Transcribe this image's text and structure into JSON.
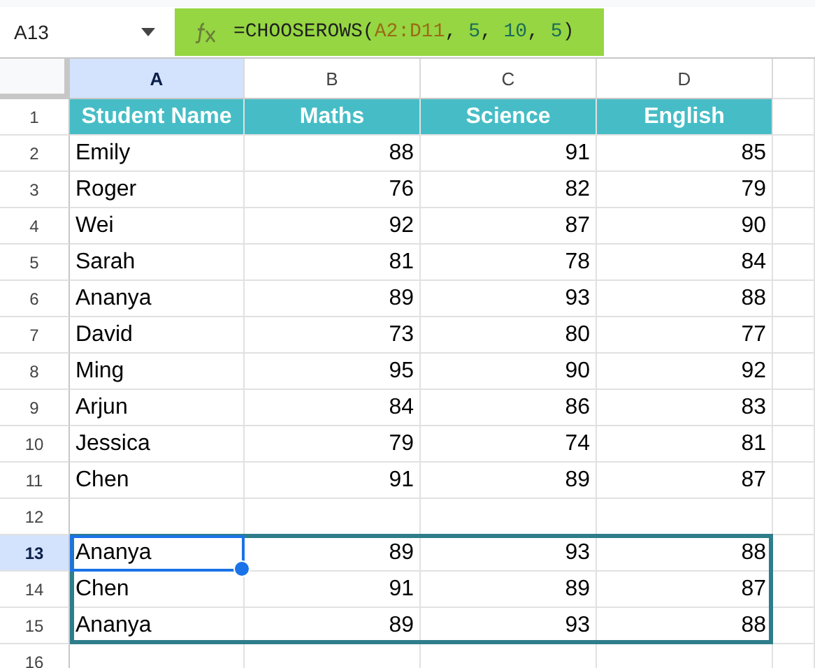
{
  "name_box": {
    "value": "A13"
  },
  "formula_bar": {
    "segments": [
      {
        "kind": "plain",
        "text": "=CHOOSEROWS("
      },
      {
        "kind": "range",
        "text": "A2:D11"
      },
      {
        "kind": "plain",
        "text": ", "
      },
      {
        "kind": "number",
        "text": "5"
      },
      {
        "kind": "plain",
        "text": ", "
      },
      {
        "kind": "number",
        "text": "10"
      },
      {
        "kind": "plain",
        "text": ", "
      },
      {
        "kind": "number",
        "text": "5"
      },
      {
        "kind": "plain",
        "text": ")"
      }
    ]
  },
  "columns": [
    {
      "label": "A",
      "selected": true
    },
    {
      "label": "B",
      "selected": false
    },
    {
      "label": "C",
      "selected": false
    },
    {
      "label": "D",
      "selected": false
    }
  ],
  "rows": [
    {
      "number": "1",
      "kind": "header",
      "selected": false,
      "in_output": false,
      "cells": [
        "Student Name",
        "Maths",
        "Science",
        "English"
      ]
    },
    {
      "number": "2",
      "kind": "data",
      "selected": false,
      "in_output": false,
      "cells": [
        "Emily",
        "88",
        "91",
        "85"
      ]
    },
    {
      "number": "3",
      "kind": "data",
      "selected": false,
      "in_output": false,
      "cells": [
        "Roger",
        "76",
        "82",
        "79"
      ]
    },
    {
      "number": "4",
      "kind": "data",
      "selected": false,
      "in_output": false,
      "cells": [
        "Wei",
        "92",
        "87",
        "90"
      ]
    },
    {
      "number": "5",
      "kind": "data",
      "selected": false,
      "in_output": false,
      "cells": [
        "Sarah",
        "81",
        "78",
        "84"
      ]
    },
    {
      "number": "6",
      "kind": "data",
      "selected": false,
      "in_output": false,
      "cells": [
        "Ananya",
        "89",
        "93",
        "88"
      ]
    },
    {
      "number": "7",
      "kind": "data",
      "selected": false,
      "in_output": false,
      "cells": [
        "David",
        "73",
        "80",
        "77"
      ]
    },
    {
      "number": "8",
      "kind": "data",
      "selected": false,
      "in_output": false,
      "cells": [
        "Ming",
        "95",
        "90",
        "92"
      ]
    },
    {
      "number": "9",
      "kind": "data",
      "selected": false,
      "in_output": false,
      "cells": [
        "Arjun",
        "84",
        "86",
        "83"
      ]
    },
    {
      "number": "10",
      "kind": "data",
      "selected": false,
      "in_output": false,
      "cells": [
        "Jessica",
        "79",
        "74",
        "81"
      ]
    },
    {
      "number": "11",
      "kind": "data",
      "selected": false,
      "in_output": false,
      "cells": [
        "Chen",
        "91",
        "89",
        "87"
      ]
    },
    {
      "number": "12",
      "kind": "data",
      "selected": false,
      "in_output": false,
      "cells": []
    },
    {
      "number": "13",
      "kind": "data",
      "selected": true,
      "in_output": true,
      "cells": [
        "Ananya",
        "89",
        "93",
        "88"
      ]
    },
    {
      "number": "14",
      "kind": "data",
      "selected": false,
      "in_output": true,
      "cells": [
        "Chen",
        "91",
        "89",
        "87"
      ]
    },
    {
      "number": "15",
      "kind": "data",
      "selected": false,
      "in_output": true,
      "cells": [
        "Ananya",
        "89",
        "93",
        "88"
      ]
    },
    {
      "number": "16",
      "kind": "data",
      "selected": false,
      "in_output": false,
      "cells": []
    }
  ]
}
